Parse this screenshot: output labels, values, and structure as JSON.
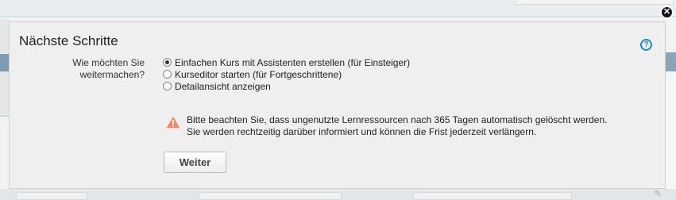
{
  "dialog": {
    "title": "Nächste Schritte",
    "help_icon": "question-circle-icon",
    "close_icon": "close-x-icon",
    "question_line1": "Wie möchten Sie",
    "question_line2": "weitermachen?",
    "options": [
      {
        "label": "Einfachen Kurs mit Assistenten erstellen (für Einsteiger)",
        "checked": true
      },
      {
        "label": "Kurseditor starten (für Fortgeschrittene)",
        "checked": false
      },
      {
        "label": "Detailansicht anzeigen",
        "checked": false
      }
    ],
    "warning_icon": "warning-triangle-icon",
    "warning_line1": "Bitte beachten Sie, dass ungenutzte Lernressourcen nach 365 Tagen automatisch gelöscht werden.",
    "warning_line2": "Sie werden rechtzeitig darüber informiert und können die Frist jederzeit verlängern.",
    "next_button": "Weiter"
  },
  "colors": {
    "help_icon": "#1a8fbf",
    "warning_icon": "#f08a6b",
    "dialog_background": "#efefef"
  }
}
